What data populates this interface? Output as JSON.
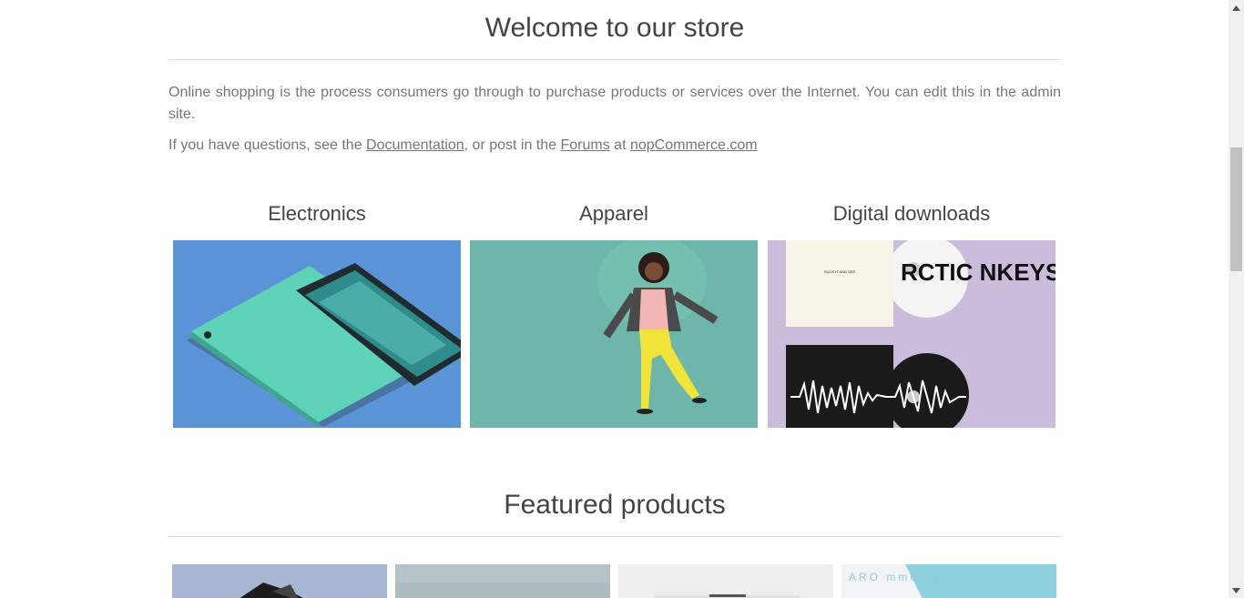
{
  "welcome": {
    "title": "Welcome to our store",
    "paragraph1": "Online shopping is the process consumers go through to purchase products or services over the Internet. You can edit this in the admin site.",
    "questions_prefix": "If you have questions, see the ",
    "documentation_link": "Documentation",
    "questions_mid": ", or post in the ",
    "forums_link": "Forums",
    "questions_at": " at ",
    "site_link": "nopCommerce.com"
  },
  "categories": [
    {
      "title": "Electronics",
      "image": "electronics-phone-image"
    },
    {
      "title": "Apparel",
      "image": "apparel-jumping-woman-image"
    },
    {
      "title": "Digital downloads",
      "image": "digital-downloads-album-image"
    }
  ],
  "album": {
    "small_text": "SUCK IT AND SEE",
    "cover_text": "RCTIC NKEYS"
  },
  "featured": {
    "title": "Featured products",
    "products": [
      {
        "image": "product-image-1"
      },
      {
        "image": "product-image-2"
      },
      {
        "image": "product-image-3"
      },
      {
        "image": "product-image-4"
      }
    ],
    "partial_text": "ARO mmerce"
  },
  "colors": {
    "electronics_bg": "#5b94d6",
    "apparel_bg": "#6db6a9",
    "digital_bg": "#cbbcdc",
    "text": "#444444",
    "muted_text": "#777777"
  }
}
